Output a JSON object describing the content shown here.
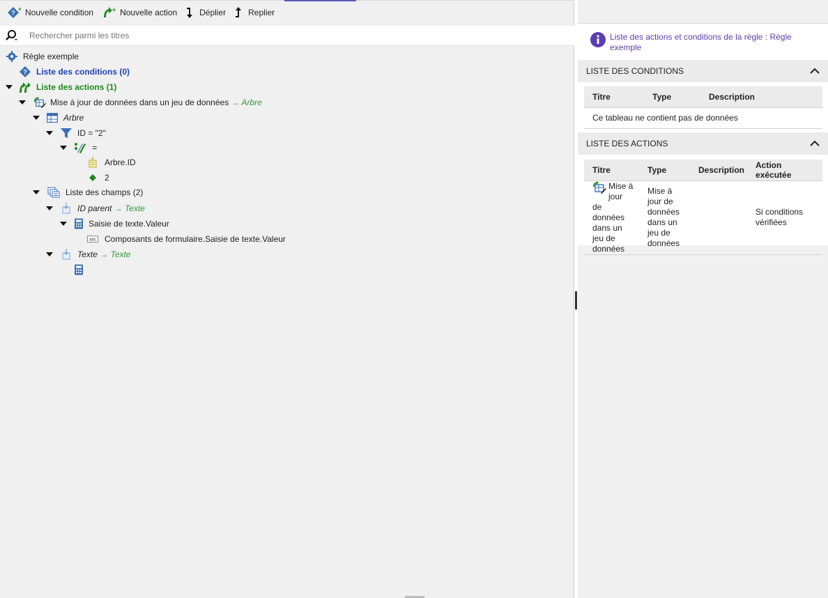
{
  "toolbar": {
    "new_condition": "Nouvelle condition",
    "new_action": "Nouvelle action",
    "expand": "Déplier",
    "collapse": "Replier"
  },
  "search": {
    "placeholder": "Rechercher parmi les titres"
  },
  "tree": {
    "rule": "Règle exemple",
    "conditions": "Liste des conditions (0)",
    "actions": "Liste des actions (1)",
    "action1": "Mise à jour de données dans un jeu de données",
    "action1_target": "→ Arbre",
    "table": "Arbre",
    "filter": "ID = \"2\"",
    "operator": "=",
    "field_ref": "Arbre.ID",
    "value": "2",
    "fields": "Liste des champs (2)",
    "field1": "ID parent",
    "field1_type": "→ Texte",
    "field1_expr": "Saisie de texte.Valeur",
    "field1_source": "Composants de formulaire.Saisie de texte.Valeur",
    "field2": "Texte",
    "field2_type": "→ Texte"
  },
  "right": {
    "info": "Liste des actions et conditions de la règle : Règle exemple",
    "conditions_header": "LISTE DES CONDITIONS",
    "conditions_cols": [
      "Titre",
      "Type",
      "Description"
    ],
    "conditions_empty": "Ce tableau ne contient pas de données",
    "actions_header": "LISTE DES ACTIONS",
    "actions_cols": [
      "Titre",
      "Type",
      "Description",
      "Action exécutée"
    ],
    "actions_row": {
      "title": "Mise à jour de données dans un jeu de données",
      "type": "Mise à jour de données dans un jeu de données",
      "description": "",
      "executed": "Si conditions vérifiées"
    }
  },
  "colors": {
    "accent": "#5b5bb8",
    "blue": "#1d3fbf",
    "green": "#1e8a1e",
    "info": "#5a3fb0"
  }
}
